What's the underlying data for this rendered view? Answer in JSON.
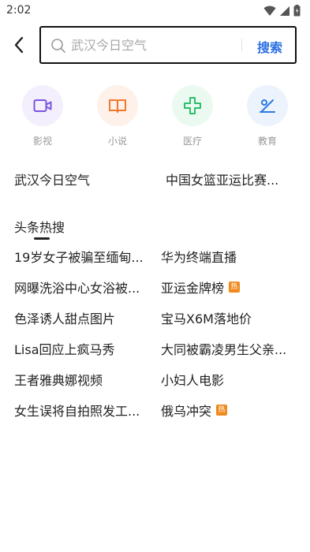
{
  "status": {
    "time": "2:02"
  },
  "search": {
    "placeholder": "武汉今日空气",
    "button_label": "搜索"
  },
  "categories": [
    {
      "label": "影视",
      "icon": "video-icon",
      "color": "#7a55e0",
      "bg": "#f3effc"
    },
    {
      "label": "小说",
      "icon": "book-icon",
      "color": "#f0772b",
      "bg": "#fdf1ea"
    },
    {
      "label": "医疗",
      "icon": "medical-cross-icon",
      "color": "#2bbf6a",
      "bg": "#eafaf1"
    },
    {
      "label": "教育",
      "icon": "education-icon",
      "color": "#2b7ae0",
      "bg": "#ecf3fd"
    }
  ],
  "suggestions": [
    "武汉今日空气",
    "中国女篮亚运比赛..."
  ],
  "hot": {
    "title": "头条热搜",
    "badge_label": "热",
    "items": [
      {
        "text": "19岁女子被骗至缅甸...",
        "hot": false
      },
      {
        "text": "华为终端直播",
        "hot": false
      },
      {
        "text": "网曝洗浴中心女浴被...",
        "hot": false
      },
      {
        "text": "亚运金牌榜",
        "hot": true
      },
      {
        "text": "色泽诱人甜点图片",
        "hot": false
      },
      {
        "text": "宝马X6M落地价",
        "hot": false
      },
      {
        "text": "Lisa回应上疯马秀",
        "hot": false
      },
      {
        "text": "大同被霸凌男生父亲...",
        "hot": false
      },
      {
        "text": "王者雅典娜视频",
        "hot": false
      },
      {
        "text": "小妇人电影",
        "hot": false
      },
      {
        "text": "女生误将自拍照发工...",
        "hot": false
      },
      {
        "text": "俄乌冲突",
        "hot": true
      }
    ]
  }
}
